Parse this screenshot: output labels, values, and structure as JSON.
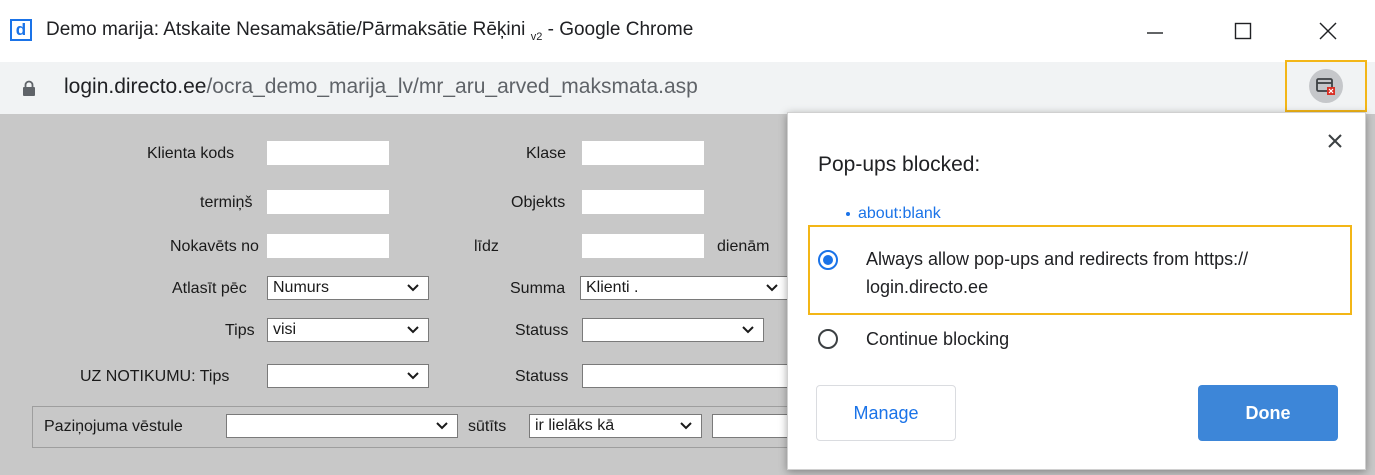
{
  "window": {
    "logo_letter": "d",
    "title_main": "Demo marija: Atskaite Nesamaksātie/Pārmaksātie Rēķini",
    "title_sub": "v2",
    "title_suffix": " - Google Chrome"
  },
  "address": {
    "host": "login.directo.ee",
    "path": "/ocra_demo_marija_lv/mr_aru_arved_maksmata.asp"
  },
  "form": {
    "klienta_kods_label": "Klienta kods",
    "klase_label": "Klase",
    "termins_label": "termiņš",
    "objekts_label": "Objekts",
    "nokavets_label": "Nokavēts no",
    "lidz_label": "līdz",
    "dienam_label": "dienām",
    "atlasit_label": "Atlasīt pēc",
    "atlasit_value": "Numurs",
    "summa_label": "Summa",
    "summa_value": "Klienti .",
    "tips_label": "Tips",
    "tips_value": "visi",
    "statuss_label": "Statuss",
    "statuss_value": "",
    "uz_tips_label": "UZ NOTIKUMU: Tips",
    "uz_tips_value": "",
    "uz_statuss_label": "Statuss",
    "pazinojuma_label": "Paziņojuma vēstule",
    "pazinojuma_value": "",
    "sutits_label": "sūtīts",
    "sutits_value": "ir lielāks kā"
  },
  "dialog": {
    "title": "Pop-ups blocked:",
    "link": "about:blank",
    "option_allow_line1": "Always allow pop-ups and redirects from https://",
    "option_allow_line2": "login.directo.ee",
    "option_block": "Continue blocking",
    "manage_label": "Manage",
    "done_label": "Done"
  },
  "colors": {
    "accent": "#1a73e8",
    "highlight": "#f3b617",
    "page_bg": "#c8c8c8"
  }
}
